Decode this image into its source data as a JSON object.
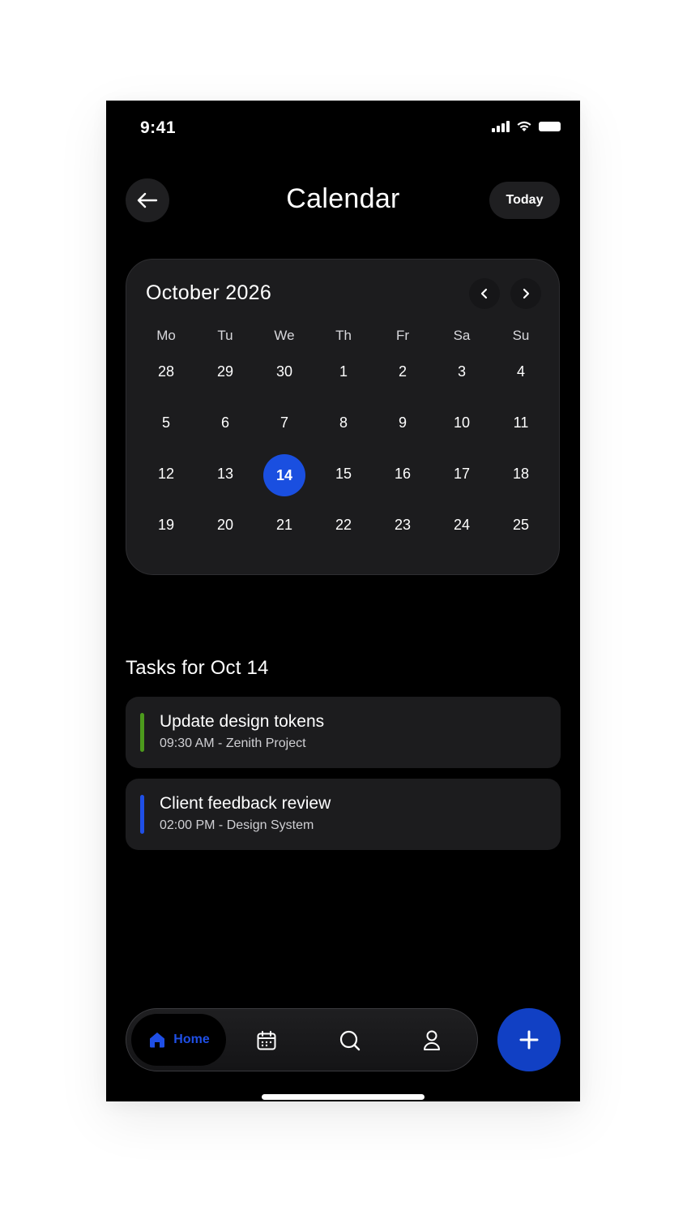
{
  "status_bar": {
    "time": "9:41"
  },
  "header": {
    "title": "Calendar",
    "today_label": "Today"
  },
  "calendar": {
    "month_label": "October 2026",
    "weekdays": [
      "Mo",
      "Tu",
      "We",
      "Th",
      "Fr",
      "Sa",
      "Su"
    ],
    "weeks": [
      [
        "28",
        "29",
        "30",
        "1",
        "2",
        "3",
        "4"
      ],
      [
        "5",
        "6",
        "7",
        "8",
        "9",
        "10",
        "11"
      ],
      [
        "12",
        "13",
        "14",
        "15",
        "16",
        "17",
        "18"
      ],
      [
        "19",
        "20",
        "21",
        "22",
        "23",
        "24",
        "25"
      ]
    ],
    "selected_day": "14",
    "accent_color": "#1a4fe0"
  },
  "tasks": {
    "heading": "Tasks for Oct 14",
    "items": [
      {
        "title": "Update design tokens",
        "subtitle": "09:30 AM - Zenith Project",
        "color": "#4c9a1c"
      },
      {
        "title": "Client feedback review",
        "subtitle": "02:00 PM - Design System",
        "color": "#1f4fe6"
      }
    ]
  },
  "bottom_nav": {
    "home_label": "Home",
    "icons": [
      "home-icon",
      "calendar-icon",
      "search-icon",
      "profile-icon"
    ],
    "fab_icon": "plus-icon",
    "active_color": "#1f4fe6"
  }
}
